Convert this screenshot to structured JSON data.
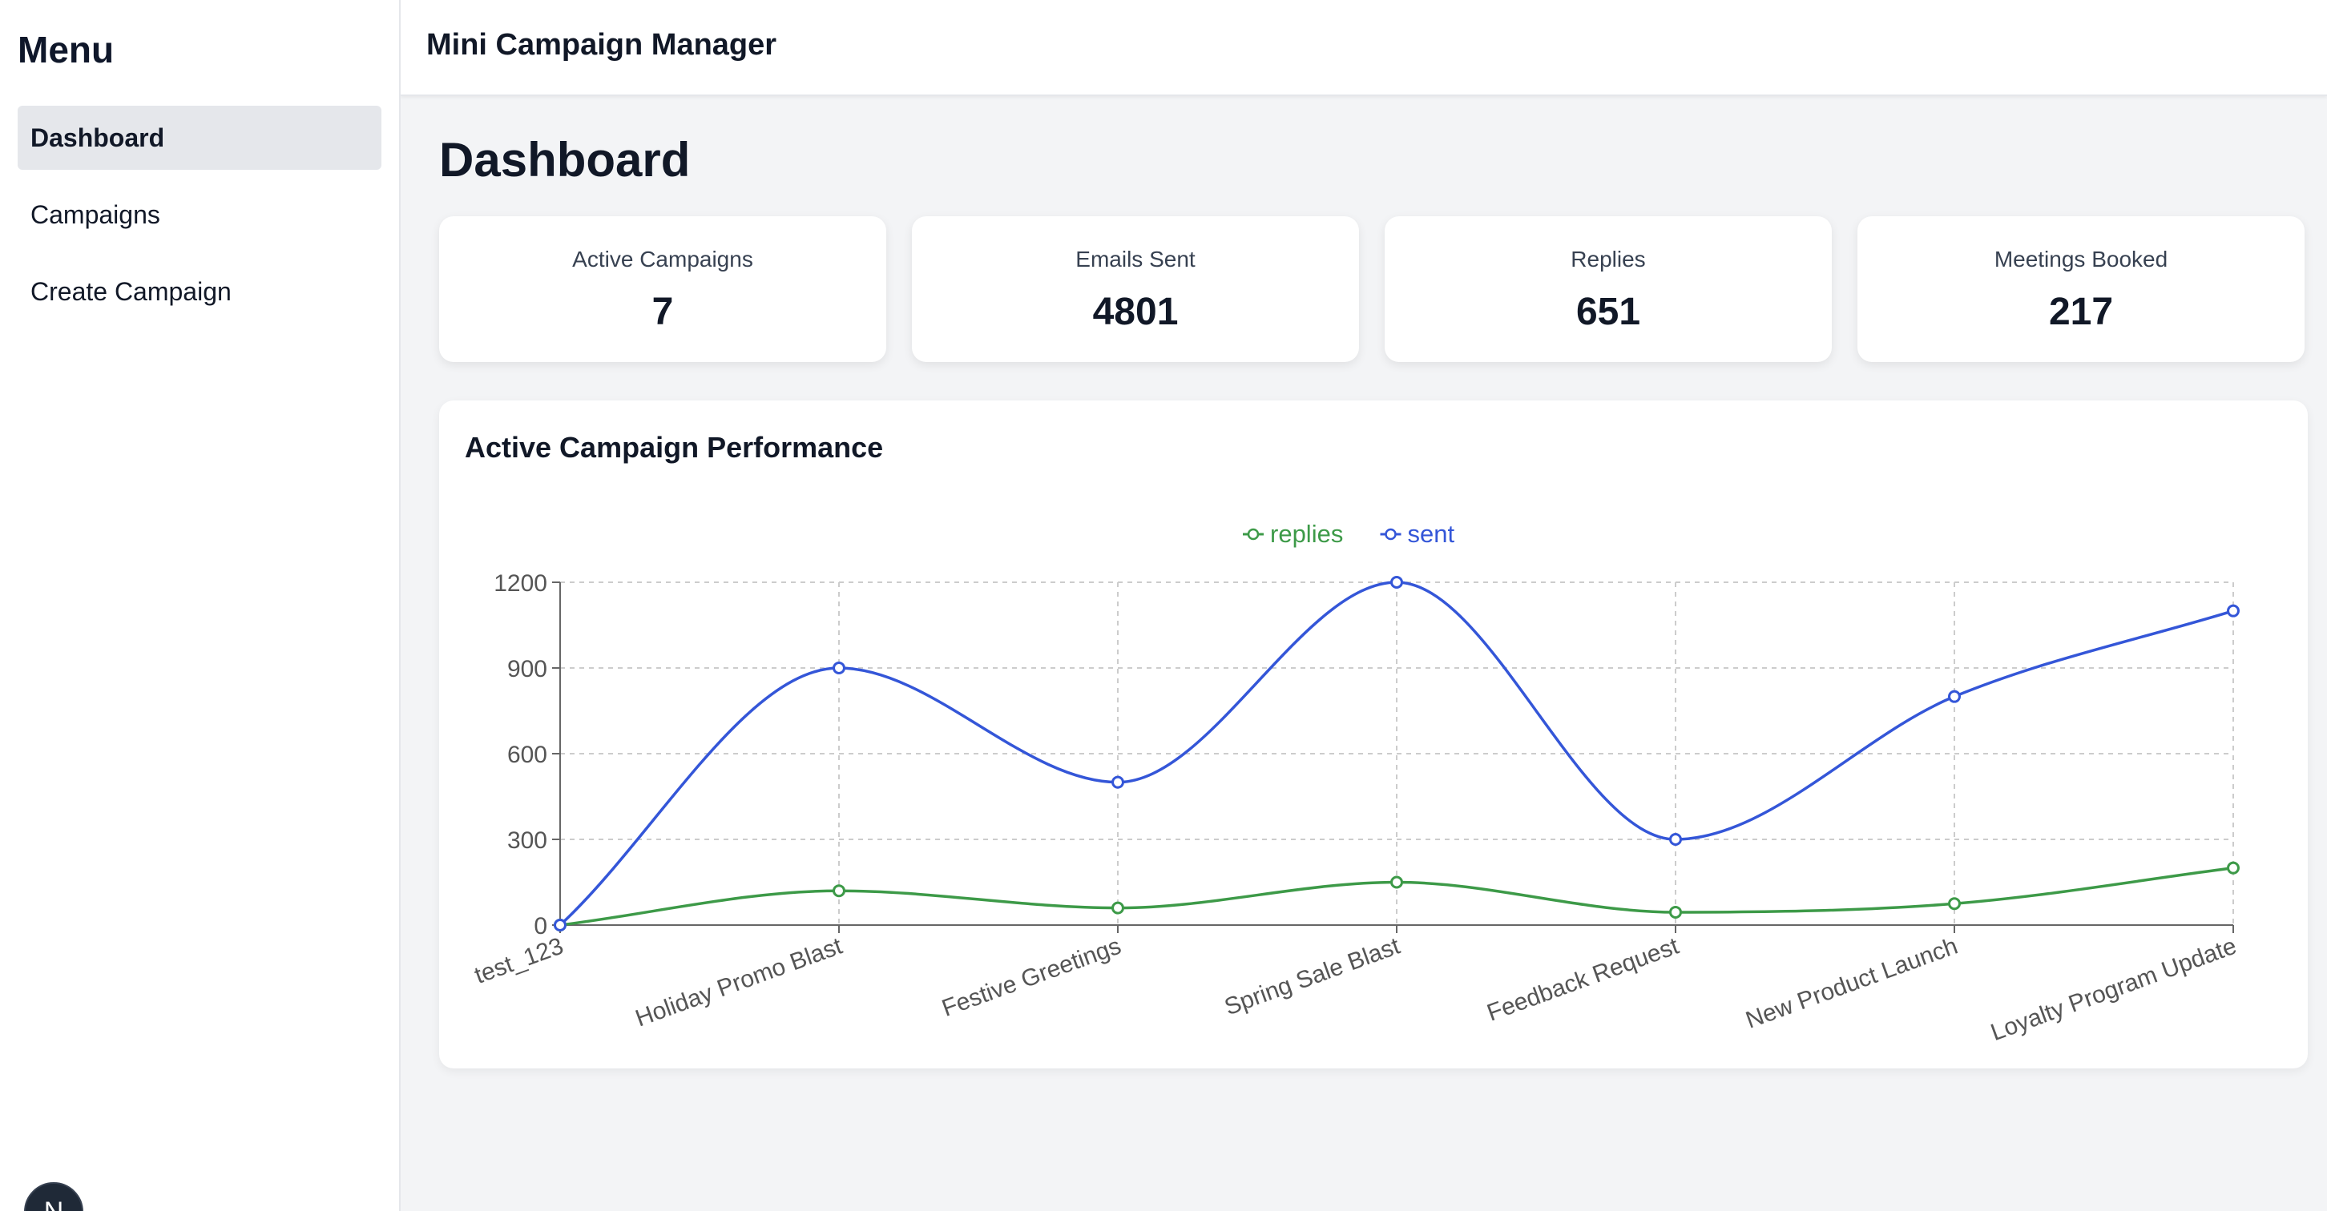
{
  "sidebar": {
    "title": "Menu",
    "items": [
      {
        "label": "Dashboard",
        "active": true
      },
      {
        "label": "Campaigns",
        "active": false
      },
      {
        "label": "Create Campaign",
        "active": false
      }
    ],
    "avatar_letter": "N"
  },
  "header": {
    "app_title": "Mini Campaign Manager"
  },
  "main": {
    "page_title": "Dashboard",
    "stats": [
      {
        "label": "Active Campaigns",
        "value": "7"
      },
      {
        "label": "Emails Sent",
        "value": "4801"
      },
      {
        "label": "Replies",
        "value": "651"
      },
      {
        "label": "Meetings Booked",
        "value": "217"
      }
    ]
  },
  "chart_data": {
    "type": "line",
    "title": "Active Campaign Performance",
    "categories": [
      "test_123",
      "Holiday Promo Blast",
      "Festive Greetings",
      "Spring Sale Blast",
      "Feedback Request",
      "New Product Launch",
      "Loyalty Program Update"
    ],
    "series": [
      {
        "name": "replies",
        "color": "#3d9a48",
        "values": [
          0,
          120,
          60,
          150,
          45,
          75,
          200
        ]
      },
      {
        "name": "sent",
        "color": "#3456d8",
        "values": [
          0,
          900,
          500,
          1200,
          300,
          800,
          1100
        ]
      }
    ],
    "yticks": [
      0,
      300,
      600,
      900,
      1200
    ],
    "ylim": [
      0,
      1200
    ],
    "grid": true,
    "legend_position": "top-center",
    "curve": "smooth"
  },
  "colors": {
    "sidebar_active_bg": "#e5e7eb",
    "page_bg": "#f3f4f6",
    "grid": "#cccccc",
    "axis_text": "#555555"
  }
}
